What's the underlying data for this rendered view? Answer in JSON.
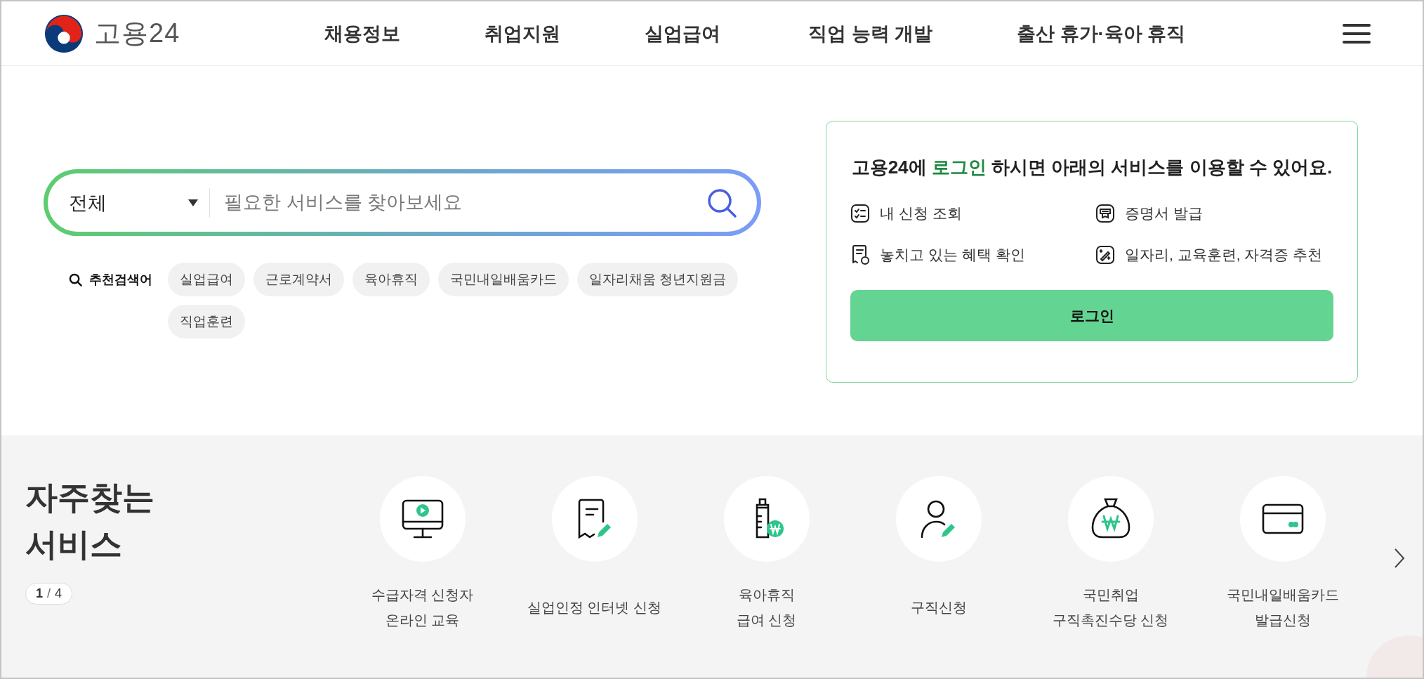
{
  "header": {
    "logo_text": "고용24",
    "nav": [
      "채용정보",
      "취업지원",
      "실업급여",
      "직업 능력 개발",
      "출산 휴가·육아 휴직"
    ]
  },
  "search": {
    "scope": "전체",
    "placeholder": "필요한 서비스를 찾아보세요",
    "recommend_label": "추천검색어",
    "keywords": [
      "실업급여",
      "근로계약서",
      "육아휴직",
      "국민내일배움카드",
      "일자리채움 청년지원금",
      "직업훈련"
    ]
  },
  "login_card": {
    "prompt": "고용24에 **로그인** 하시면 아래의 서비스를 이용할 수 있어요.",
    "benefits": [
      "내 신청 조회",
      "증명서 발급",
      "놓치고 있는 혜택 확인",
      "일자리, 교육훈련, 자격증 추천"
    ],
    "button": "로그인"
  },
  "frequent": {
    "title": "자주찾는 서비스",
    "page_current": "1",
    "page_separator": "/",
    "page_total": "4",
    "services": [
      {
        "lines": [
          "수급자격 신청자",
          "온라인 교육"
        ]
      },
      {
        "lines": [
          "실업인정 인터넷 신청"
        ]
      },
      {
        "lines": [
          "육아휴직",
          "급여 신청"
        ]
      },
      {
        "lines": [
          "구직신청"
        ]
      },
      {
        "lines": [
          "국민취업",
          "구직촉진수당 신청"
        ]
      },
      {
        "lines": [
          "국민내일배움카드",
          "발급신청"
        ]
      }
    ]
  }
}
